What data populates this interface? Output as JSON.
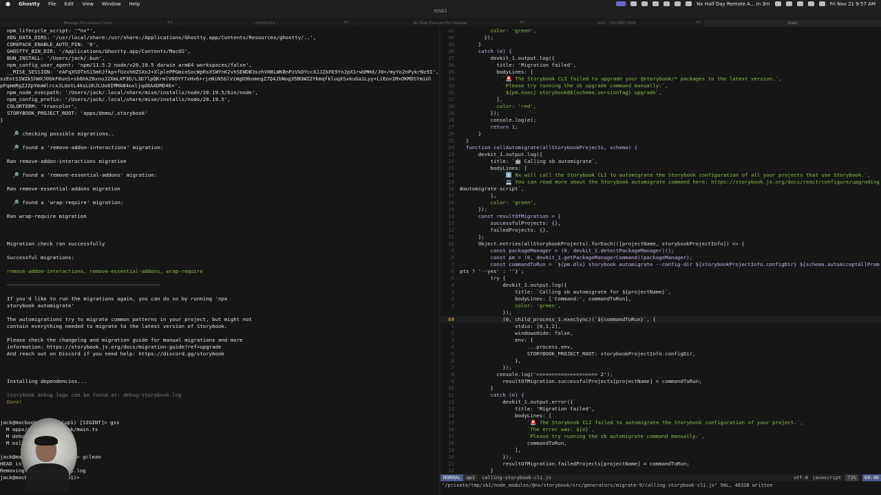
{
  "menubar": {
    "app": "Ghostty",
    "items": [
      "File",
      "Edit",
      "View",
      "Window",
      "Help"
    ],
    "meeting": "Nx Half Day Remote A... in 3m",
    "datetime": "Fri Nov 21  9:57 AM"
  },
  "window": {
    "title": "/t/sb1"
  },
  "tabs": [
    {
      "label": "Message Punctuation Check",
      "kb": "⌘1"
    },
    {
      "label": "~/p/nf20.8.x",
      "kb": "⌘2"
    },
    {
      "label": "Nx Node Executor Port Release",
      "kb": "⌘3"
    },
    {
      "label": "nvim ~/p/nj/NXC-3504",
      "kb": "⌘4"
    },
    {
      "label": "/t/sb1",
      "kb": ""
    }
  ],
  "left_terminal": [
    {
      "t": "npm_lifecycle_script: '\"nx\"',",
      "c": "w"
    },
    {
      "t": "XDG_DATA_DIRS: '/usr/local/share:/usr/share:/Applications/Ghostty.app/Contents/Resources/ghostty/..',",
      "c": "w"
    },
    {
      "t": "COREPACK_ENABLE_AUTO_PIN: '0',",
      "c": "w"
    },
    {
      "t": "GHOSTTY_BIN_DIR: '/Applications/Ghostty.app/Contents/MacOS',",
      "c": "w"
    },
    {
      "t": "BUN_INSTALL: '/Users/jack/.bun',",
      "c": "w"
    },
    {
      "t": "npm_config_user_agent: 'npm/11.5.2 node/v20.19.5 darwin arm64 workspaces/false',",
      "c": "w"
    },
    {
      "t": "__MISE_SESSION: 'eAFqXSOTnSi5mhJfkp+fUzxhHZSXnJ+XlplePPGminSocWpRsXSWYnK2vhSEWDB3szhVH8LWKBnPzVkDYccXJJZkFE9YnJpX1rwUMHd/J0+/myYo2nPykrNz9I',",
      "c": "w"
    },
    {
      "t": "szEotSIWZkShWXJ0bkF0unS+sb6hkZ6xnoJ2XmLXP3D/L3D7lpQKrmlV6OYY7xHv6+rjeNiNSblViWgG9komegZ7Q4JbNog35BUWZ2YkmqfkluqXSxkuGa1Lyy+LiEov1MxOKMDSYmiUl",
      "c": "w",
      "noindent": true
    },
    {
      "t": "pFqmmRgZJZpYmaWlrcxJLUotL4ksLUhJLUo8IMMAB4oxljqd8AADMD4E+',",
      "c": "w",
      "noindent": true
    },
    {
      "t": "npm_node_execpath: '/Users/jack/.local/share/mise/installs/node/20.19.5/bin/node',",
      "c": "w"
    },
    {
      "t": "npm_config_prefix: '/Users/jack/.local/share/mise/installs/node/20.19.5',",
      "c": "w"
    },
    {
      "t": "COLORTERM: 'truecolor',",
      "c": "w"
    },
    {
      "t": "STORYBOOK_PROJECT_ROOT: 'apps/demo/.storybook'",
      "c": "w"
    },
    {
      "t": "}",
      "c": "w",
      "noindent": true
    },
    {
      "t": "",
      "c": "w"
    },
    {
      "t": "  🔎 checking possible migrations..",
      "c": "w"
    },
    {
      "t": "",
      "c": "w"
    },
    {
      "t": "  🔎 found a 'remove-addon-interactions' migration:",
      "c": "w"
    },
    {
      "t": "",
      "c": "w"
    },
    {
      "t": "Ran remove-addon-interactions migration",
      "c": "w"
    },
    {
      "t": "",
      "c": "w"
    },
    {
      "t": "  🔎 found a 'remove-essential-addons' migration:",
      "c": "w"
    },
    {
      "t": "",
      "c": "w"
    },
    {
      "t": "Ran remove-essential-addons migration",
      "c": "w"
    },
    {
      "t": "",
      "c": "w"
    },
    {
      "t": "  🔎 found a 'wrap-require' migration:",
      "c": "w"
    },
    {
      "t": "",
      "c": "w"
    },
    {
      "t": "Ran wrap-require migration",
      "c": "w"
    },
    {
      "t": "",
      "c": "w"
    },
    {
      "t": "",
      "c": "w"
    },
    {
      "t": "",
      "c": "w"
    },
    {
      "t": "Migration check ran successfully",
      "c": "w"
    },
    {
      "t": "",
      "c": "w"
    },
    {
      "t": "Successful migrations:",
      "c": "w"
    },
    {
      "t": "",
      "c": "w"
    },
    {
      "t": "remove-addon-interactions, remove-essential-addons, wrap-require",
      "c": "g"
    },
    {
      "t": "",
      "c": "w"
    },
    {
      "t": "──────────────────────────────────────────────────",
      "c": "grey"
    },
    {
      "t": "",
      "c": "w"
    },
    {
      "t": "If you'd like to run the migrations again, you can do so by running 'npx",
      "c": "w"
    },
    {
      "t": "storybook automigrate'",
      "c": "w"
    },
    {
      "t": "",
      "c": "w"
    },
    {
      "t": "The automigrations try to migrate common patterns in your project, but might not",
      "c": "w"
    },
    {
      "t": "contain everything needed to migrate to the latest version of Storybook.",
      "c": "w"
    },
    {
      "t": "",
      "c": "w"
    },
    {
      "t": "Please check the changelog and migration guide for manual migrations and more",
      "c": "w"
    },
    {
      "t": "information: https://storybook.js.org/docs/migration-guide?ref=upgrade",
      "c": "w"
    },
    {
      "t": "And reach out on Discord if you need help: https://discord.gg/storybook",
      "c": "w"
    },
    {
      "t": "",
      "c": "w"
    },
    {
      "t": "",
      "c": "w"
    },
    {
      "t": "",
      "c": "w"
    },
    {
      "t": "Installing dependencies...",
      "c": "w"
    },
    {
      "t": "",
      "c": "w"
    },
    {
      "t": "Storybook debug logs can be found at: debug-storybook.log",
      "c": "grey"
    },
    {
      "t": "Done!",
      "c": "o"
    },
    {
      "t": "",
      "c": "w"
    },
    {
      "t": "",
      "c": "w"
    },
    {
      "t": "jack@macbook /t/sb1 (up1) [SIGINT]> gss",
      "c": "w",
      "noindent": true
    },
    {
      "t": "  M apps/demo/.storybook/main.ts",
      "c": "w",
      "noindent": true
    },
    {
      "t": "  M debug-storybook.log",
      "c": "w",
      "noindent": true
    },
    {
      "t": "  M eslint.config.mjs",
      "c": "w",
      "noindent": true
    },
    {
      "t": "",
      "c": "w"
    },
    {
      "t": "jack@macbook /t/sb1 (up1)> gclean",
      "c": "w",
      "noindent": true
    },
    {
      "t": "HEAD is now at update",
      "c": "w",
      "noindent": true
    },
    {
      "t": "Removing debug-storybook.log",
      "c": "w",
      "noindent": true
    },
    {
      "t": "jack@macbook /t/sb1 (up1)>",
      "c": "w",
      "noindent": true
    }
  ],
  "editor": {
    "current_line": "69",
    "lines": [
      {
        "n": "41",
        "t": "          color: 'green',"
      },
      {
        "n": "40",
        "t": "        });"
      },
      {
        "n": "39",
        "t": "      }"
      },
      {
        "n": "38",
        "t": "      catch (e) {"
      },
      {
        "n": "37",
        "t": "          devkit_1.output.log({"
      },
      {
        "n": "36",
        "t": "            title: 'Migration failed',"
      },
      {
        "n": "35",
        "t": "            bodyLines: ["
      },
      {
        "n": "34",
        "t": "              `🚨 The Storybook CLI failed to upgrade your @storybook/* packages to the latest version.`,"
      },
      {
        "n": "33",
        "t": "              `Please try running the sb upgrade command manually:`,"
      },
      {
        "n": "32",
        "t": "              `${pm.exec} storybook@${schema.versionTag} upgrade`,"
      },
      {
        "n": "31",
        "t": "            ],"
      },
      {
        "n": "30",
        "t": "            color: 'red',"
      },
      {
        "n": "29",
        "t": "          });"
      },
      {
        "n": "28",
        "t": "          console.log(e);"
      },
      {
        "n": "27",
        "t": "          return 1;"
      },
      {
        "n": "26",
        "t": "      }"
      },
      {
        "n": "25",
        "t": "  }"
      },
      {
        "n": "24",
        "t": "  function callAutomigrate(allStorybookProjects, schema) {"
      },
      {
        "n": "23",
        "t": "      devkit_1.output.log({"
      },
      {
        "n": "22",
        "t": "          title: `🤖 Calling sb automigrate`,"
      },
      {
        "n": "21",
        "t": "          bodyLines: ["
      },
      {
        "n": "20",
        "t": "              `ℹ️ Nx will call the Storybook CLI to automigrate the Storybook configuration of all your projects that use Storybook.`,"
      },
      {
        "n": "19",
        "t": "              `💻 You can read more about the Storybook automigrate command here: https://storybook.js.org/docs/react/configure/upgrading"
      },
      {
        "n": "18",
        "t": "#automigrate-script`,"
      },
      {
        "n": "17",
        "t": "          ],"
      },
      {
        "n": "16",
        "t": "          color: 'green',"
      },
      {
        "n": "15",
        "t": "      });"
      },
      {
        "n": "14",
        "t": "      const resultOfMigration = {"
      },
      {
        "n": "13",
        "t": "          successfulProjects: {},"
      },
      {
        "n": "12",
        "t": "          failedProjects: {},"
      },
      {
        "n": "11",
        "t": "      };"
      },
      {
        "n": "10",
        "t": "      Object.entries(allStorybookProjects).forEach(([projectName, storybookProjectInfo]) => {"
      },
      {
        "n": "9",
        "t": "          const packageManager = (0, devkit_1.detectPackageManager)();"
      },
      {
        "n": "8",
        "t": "          const pm = (0, devkit_1.getPackageManagerCommand)(packageManager);"
      },
      {
        "n": "7",
        "t": "          const commandToRun = `${pm.dlx} storybook automigrate --config-dir ${storybookProjectInfo.configDir} ${schema.autoAcceptAllProm"
      },
      {
        "n": "6",
        "t": "pts ? '--yes' : ''}`;"
      },
      {
        "n": "5",
        "t": "          try {"
      },
      {
        "n": "4",
        "t": "              devkit_1.output.log({"
      },
      {
        "n": "3",
        "t": "                  title: `Calling sb automigrate for ${projectName}`,"
      },
      {
        "n": "2",
        "t": "                  bodyLines: ['Command:', commandToRun],"
      },
      {
        "n": "1",
        "t": "                  color: 'green',"
      },
      {
        "n": "",
        "t": "              });"
      },
      {
        "n": "69",
        "t": "              (0, child_process_1.execSync)(`${commandToRun}`, {",
        "cur": true
      },
      {
        "n": "1",
        "t": "                  stdio: [0,1,2],"
      },
      {
        "n": "2",
        "t": "                  windowsHide: false,"
      },
      {
        "n": "3",
        "t": "                  env: {"
      },
      {
        "n": "4",
        "t": "                      ...process.env,"
      },
      {
        "n": "5",
        "t": "                      STORYBOOK_PROJECT_ROOT: storybookProjectInfo.configDir,"
      },
      {
        "n": "6",
        "t": "                  },"
      },
      {
        "n": "7",
        "t": "              });"
      },
      {
        "n": "8",
        "t": "            console.log('>>>>>>>>>>>>>>>>>>>> 2');"
      },
      {
        "n": "9",
        "t": "              resultOfMigration.successfulProjects[projectName] = commandToRun;"
      },
      {
        "n": "10",
        "t": "          }"
      },
      {
        "n": "11",
        "t": "          catch (e) {"
      },
      {
        "n": "12",
        "t": "              devkit_1.output.error({"
      },
      {
        "n": "13",
        "t": "                  title: 'Migration failed',"
      },
      {
        "n": "14",
        "t": "                  bodyLines: ["
      },
      {
        "n": "15",
        "t": "                      `🚨 The Storybook CLI failed to automigrate the Storybook configuration of your project.`,"
      },
      {
        "n": "16",
        "t": "                      `The error was: ${e}`,"
      },
      {
        "n": "17",
        "t": "                      `Please try running the sb automigrate command manually:`,"
      },
      {
        "n": "18",
        "t": "                      commandToRun,"
      },
      {
        "n": "19",
        "t": "                  ],"
      },
      {
        "n": "20",
        "t": "              });"
      },
      {
        "n": "21",
        "t": "              resultOfMigration.failedProjects[projectName] = commandToRun;"
      },
      {
        "n": "22",
        "t": "          }"
      }
    ],
    "status": {
      "mode": "NORMAL",
      "branch": "up1",
      "filename": "calling-storybook-cli.js",
      "encoding": "utf-8",
      "filetype": "javascript",
      "percent": "73%",
      "position": "69:46"
    },
    "cmdline": "\"/private/tmp/sb1/node_modules/@nx/storybook/src/generators/migrate-9/calling-storybook-cli.js\" 94L, 4833B written"
  }
}
